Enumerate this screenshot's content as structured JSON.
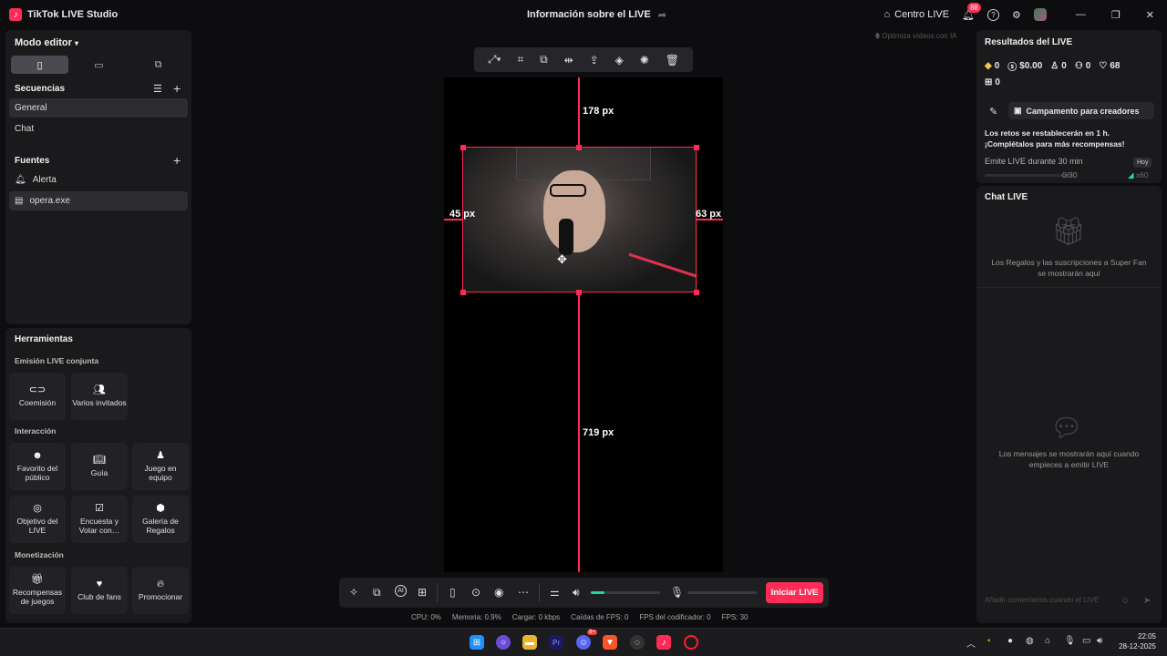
{
  "app": {
    "title": "TikTok LIVE Studio",
    "center_title": "Información sobre el LIVE",
    "centro_live": "Centro LIVE",
    "notif_count": "88"
  },
  "left": {
    "mode": "Modo editor",
    "sequences_title": "Secuencias",
    "sequences": [
      "General",
      "Chat"
    ],
    "sources_title": "Fuentes",
    "sources": [
      "Alerta",
      "opera.exe"
    ]
  },
  "tools": {
    "title": "Herramientas",
    "group_colab": "Emisión LIVE conjunta",
    "colab": [
      "Coemisión",
      "Varios invitados"
    ],
    "group_interaction": "Interacción",
    "interaction": [
      "Favorito del público",
      "Guía",
      "Juego en equipo",
      "Objetivo del LIVE",
      "Encuesta y Votar con…",
      "Galería de Regalos"
    ],
    "group_money": "Monetización",
    "money": [
      "Recompensas de juegos",
      "Club de fans",
      "Promocionar"
    ]
  },
  "canvas": {
    "optimize_hint": "Optimiza vídeos con IA",
    "top_px": "178 px",
    "left_px": "45 px",
    "right_px": "63 px",
    "bottom_px": "719 px",
    "go_live": "Iniciar LIVE",
    "mic_level": 0.2
  },
  "stats": {
    "cpu": "CPU:  0%",
    "mem": "Memoria:  0.9%",
    "load": "Cargar:  0 kbps",
    "fps_drop": "Caídas de FPS:  0",
    "enc_fps": "FPS del codificador:  0",
    "fps": "FPS:  30"
  },
  "results": {
    "title": "Resultados del LIVE",
    "values": [
      "0",
      "$0.00",
      "0",
      "0",
      "68"
    ],
    "gifts": "0",
    "campaign": "Campamento para creadores",
    "challenge_line1": "Los retos se restablecerán en 1 h.",
    "challenge_line2": "¡Complétalos para más recompensas!",
    "task": "Emite LIVE durante 30 min",
    "task_badge": "Hoy",
    "task_progress": "0/30",
    "task_reward": "x60"
  },
  "chat": {
    "title": "Chat LIVE",
    "gifts_msg": "Los Regalos y las suscripciones a Super Fan se mostrarán aquí",
    "msgs_msg": "Los mensajes se mostrarán aquí cuando empieces a emitir LIVE",
    "input_placeholder": "Añadir comentarios cuando el LIVE"
  },
  "taskbar": {
    "time": "22:05",
    "date": "28-12-2025",
    "discord_badge": "9+"
  },
  "colors": {
    "accent": "#fe2c55",
    "bg": "#0d0d0f",
    "panel": "#1a1a1c"
  }
}
